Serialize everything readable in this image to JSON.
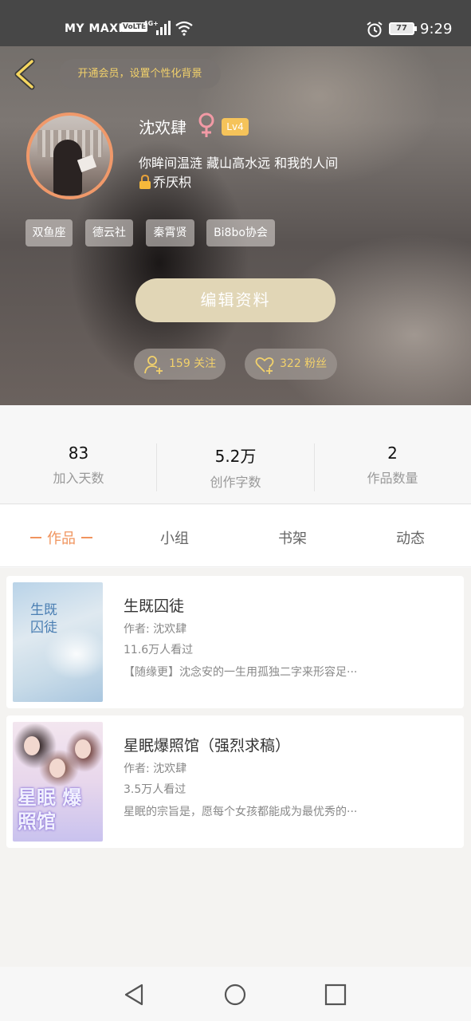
{
  "status_bar": {
    "carrier": "MY MAXIS",
    "volte": "VoLTE",
    "battery": "77",
    "time": "9:29"
  },
  "header": {
    "vip_banner": "开通会员，设置个性化背景"
  },
  "profile": {
    "username": "沈欢肆",
    "gender_symbol": "♀",
    "level": "Lv4",
    "bio_line1": "你眸间温涟 藏山高水远 和我的人间",
    "bio_line2": "乔厌枳",
    "tags": [
      "双鱼座",
      "德云社",
      "秦霄贤",
      "Bi8bo协会"
    ],
    "edit_label": "编辑资料",
    "following": "159 关注",
    "fans": "322 粉丝"
  },
  "stats": [
    {
      "value": "83",
      "label": "加入天数"
    },
    {
      "value": "5.2万",
      "label": "创作字数"
    },
    {
      "value": "2",
      "label": "作品数量"
    }
  ],
  "tabs": [
    {
      "label": "作品"
    },
    {
      "label": "小组"
    },
    {
      "label": "书架"
    },
    {
      "label": "动态"
    }
  ],
  "works": [
    {
      "title": "生既囚徒",
      "author": "作者: 沈欢肆",
      "views": "11.6万人看过",
      "desc": "【随缘更】沈念安的一生用孤独二字来形容足···",
      "cover_text": "生既 囚徒"
    },
    {
      "title": "星眠爆照馆（强烈求稿）",
      "author": "作者: 沈欢肆",
      "views": "3.5万人看过",
      "desc": "星眠的宗旨是，愿每个女孩都能成为最优秀的···",
      "cover_text": "星眠 爆照馆"
    }
  ],
  "colors": {
    "accent": "#f0945e",
    "gold_text": "#f2d16b",
    "edit_button": "#e1d6b6",
    "level_badge": "#f5c35a",
    "gender_icon": "#f29aa5"
  },
  "icons": {
    "back": "chevron-left-icon",
    "gender": "female-icon",
    "lock": "lock-icon",
    "following": "user-add-icon",
    "fans": "heart-add-icon",
    "nav_back": "triangle-back-icon",
    "nav_home": "circle-home-icon",
    "nav_recent": "square-recent-icon"
  }
}
